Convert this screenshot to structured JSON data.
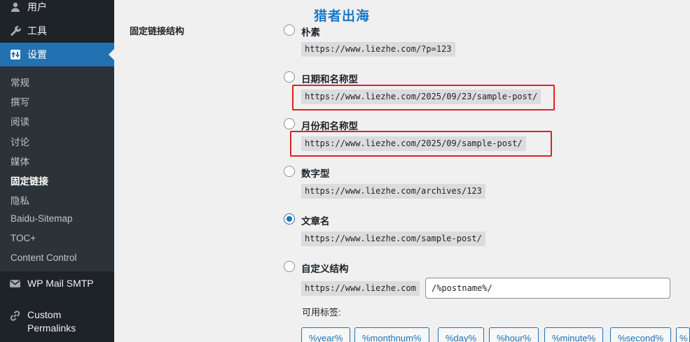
{
  "sidebar": {
    "menu": [
      {
        "label": "用户",
        "icon": "user-icon"
      },
      {
        "label": "工具",
        "icon": "wrench-icon"
      },
      {
        "label": "设置",
        "icon": "settings-icon"
      }
    ],
    "submenu": [
      "常规",
      "撰写",
      "阅读",
      "讨论",
      "媒体",
      "固定链接",
      "隐私",
      "Baidu-Sitemap",
      "TOC+",
      "Content Control"
    ],
    "active_submenu": "固定链接",
    "plugins": [
      {
        "label": "WP Mail SMTP",
        "icon": "mail-icon"
      },
      {
        "label_line1": "Custom",
        "label_line2": "Permalinks",
        "icon": "link-icon"
      }
    ]
  },
  "watermark": "猎者出海",
  "section_label": "固定链接结构",
  "options": [
    {
      "label": "朴素",
      "url": "https://www.liezhe.com/?p=123",
      "checked": false
    },
    {
      "label": "日期和名称型",
      "url": "https://www.liezhe.com/2025/09/23/sample-post/",
      "checked": false
    },
    {
      "label": "月份和名称型",
      "url": "https://www.liezhe.com/2025/09/sample-post/",
      "checked": false
    },
    {
      "label": "数字型",
      "url": "https://www.liezhe.com/archives/123",
      "checked": false
    },
    {
      "label": "文章名",
      "url": "https://www.liezhe.com/sample-post/",
      "checked": true
    },
    {
      "label": "自定义结构",
      "url": "https://www.liezhe.com",
      "checked": false
    }
  ],
  "custom_structure_value": "/%postname%/",
  "available_tags_label": "可用标签:",
  "tags": [
    "%year%",
    "%monthnum%",
    "%day%",
    "%hour%",
    "%minute%",
    "%second%",
    "%"
  ],
  "colors": {
    "sidebar_bg": "#1d2327",
    "accent": "#2271b1",
    "highlight": "#e02020"
  }
}
